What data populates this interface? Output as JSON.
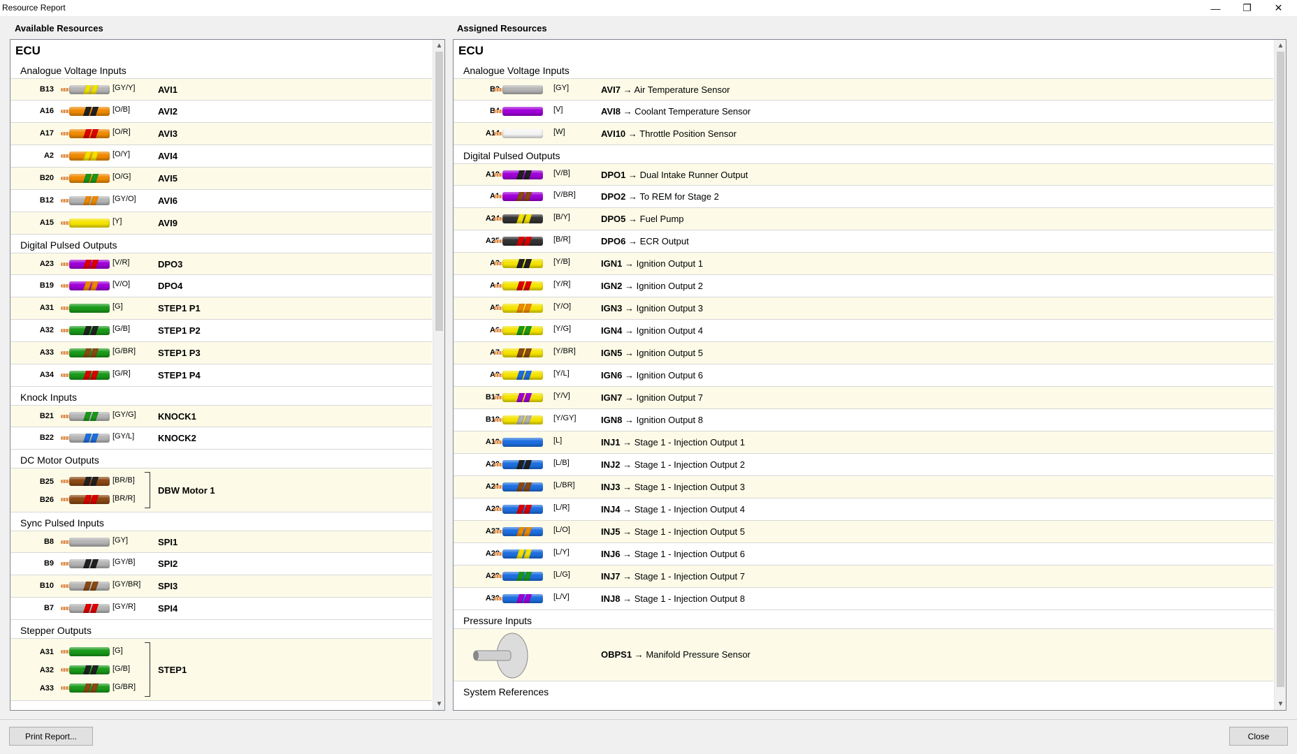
{
  "window": {
    "title": "Resource Report",
    "minimize": "—",
    "restore": "❐",
    "close": "✕"
  },
  "left": {
    "header": "Available Resources",
    "group": "ECU",
    "sections": [
      {
        "title": "Analogue Voltage Inputs",
        "rows": [
          {
            "pin": "B13",
            "code": "[GY/Y]",
            "name": "AVI1",
            "base": "#b5b5b5",
            "stripe": "#f5e400"
          },
          {
            "pin": "A16",
            "code": "[O/B]",
            "name": "AVI2",
            "base": "#f08a00",
            "stripe": "#222222"
          },
          {
            "pin": "A17",
            "code": "[O/R]",
            "name": "AVI3",
            "base": "#f08a00",
            "stripe": "#e00000"
          },
          {
            "pin": "A2",
            "code": "[O/Y]",
            "name": "AVI4",
            "base": "#f08a00",
            "stripe": "#f5e400"
          },
          {
            "pin": "B20",
            "code": "[O/G]",
            "name": "AVI5",
            "base": "#f08a00",
            "stripe": "#1a9a1a"
          },
          {
            "pin": "B12",
            "code": "[GY/O]",
            "name": "AVI6",
            "base": "#b5b5b5",
            "stripe": "#f08a00"
          },
          {
            "pin": "A15",
            "code": "[Y]",
            "name": "AVI9",
            "base": "#f5e400",
            "stripe": ""
          }
        ]
      },
      {
        "title": "Digital Pulsed Outputs",
        "rows": [
          {
            "pin": "A23",
            "code": "[V/R]",
            "name": "DPO3",
            "base": "#a000d8",
            "stripe": "#e00000"
          },
          {
            "pin": "B19",
            "code": "[V/O]",
            "name": "DPO4",
            "base": "#a000d8",
            "stripe": "#f08a00"
          },
          {
            "pin": "A31",
            "code": "[G]",
            "name": "STEP1 P1",
            "base": "#1a9a1a",
            "stripe": ""
          },
          {
            "pin": "A32",
            "code": "[G/B]",
            "name": "STEP1 P2",
            "base": "#1a9a1a",
            "stripe": "#222222"
          },
          {
            "pin": "A33",
            "code": "[G/BR]",
            "name": "STEP1 P3",
            "base": "#1a9a1a",
            "stripe": "#8b4a14"
          },
          {
            "pin": "A34",
            "code": "[G/R]",
            "name": "STEP1 P4",
            "base": "#1a9a1a",
            "stripe": "#e00000"
          }
        ]
      },
      {
        "title": "Knock Inputs",
        "rows": [
          {
            "pin": "B21",
            "code": "[GY/G]",
            "name": "KNOCK1",
            "base": "#b5b5b5",
            "stripe": "#1a9a1a"
          },
          {
            "pin": "B22",
            "code": "[GY/L]",
            "name": "KNOCK2",
            "base": "#b5b5b5",
            "stripe": "#1e6fe0"
          }
        ]
      },
      {
        "title": "DC Motor Outputs",
        "bracket": true,
        "name": "DBW Motor 1",
        "rows": [
          {
            "pin": "B25",
            "code": "[BR/B]",
            "base": "#8b4a14",
            "stripe": "#222222"
          },
          {
            "pin": "B26",
            "code": "[BR/R]",
            "base": "#8b4a14",
            "stripe": "#e00000"
          }
        ]
      },
      {
        "title": "Sync Pulsed Inputs",
        "rows": [
          {
            "pin": "B8",
            "code": "[GY]",
            "name": "SPI1",
            "base": "#b5b5b5",
            "stripe": ""
          },
          {
            "pin": "B9",
            "code": "[GY/B]",
            "name": "SPI2",
            "base": "#b5b5b5",
            "stripe": "#222222"
          },
          {
            "pin": "B10",
            "code": "[GY/BR]",
            "name": "SPI3",
            "base": "#b5b5b5",
            "stripe": "#8b4a14"
          },
          {
            "pin": "B7",
            "code": "[GY/R]",
            "name": "SPI4",
            "base": "#b5b5b5",
            "stripe": "#e00000"
          }
        ]
      },
      {
        "title": "Stepper Outputs",
        "bracket": true,
        "name": "STEP1",
        "rows": [
          {
            "pin": "A31",
            "code": "[G]",
            "base": "#1a9a1a",
            "stripe": ""
          },
          {
            "pin": "A32",
            "code": "[G/B]",
            "base": "#1a9a1a",
            "stripe": "#222222"
          },
          {
            "pin": "A33",
            "code": "[G/BR]",
            "base": "#1a9a1a",
            "stripe": "#8b4a14"
          }
        ]
      }
    ]
  },
  "right": {
    "header": "Assigned Resources",
    "group": "ECU",
    "sections": [
      {
        "title": "Analogue Voltage Inputs",
        "rows": [
          {
            "pin": "B3",
            "code": "[GY]",
            "name": "AVI7",
            "desc": "→ Air Temperature Sensor",
            "base": "#b5b5b5",
            "stripe": ""
          },
          {
            "pin": "B4",
            "code": "[V]",
            "name": "AVI8",
            "desc": "→ Coolant Temperature Sensor",
            "base": "#a000d8",
            "stripe": ""
          },
          {
            "pin": "A14",
            "code": "[W]",
            "name": "AVI10",
            "desc": "→ Throttle Position Sensor",
            "base": "#f4f4f4",
            "stripe": ""
          }
        ]
      },
      {
        "title": "Digital Pulsed Outputs",
        "rows": [
          {
            "pin": "A18",
            "code": "[V/B]",
            "name": "DPO1",
            "desc": "→ Dual Intake Runner Output",
            "base": "#a000d8",
            "stripe": "#222222"
          },
          {
            "pin": "A1",
            "code": "[V/BR]",
            "name": "DPO2",
            "desc": "→ To REM for Stage 2",
            "base": "#a000d8",
            "stripe": "#8b4a14"
          },
          {
            "pin": "A24",
            "code": "[B/Y]",
            "name": "DPO5",
            "desc": "→ Fuel Pump",
            "base": "#333333",
            "stripe": "#f5e400"
          },
          {
            "pin": "A25",
            "code": "[B/R]",
            "name": "DPO6",
            "desc": "→ ECR Output",
            "base": "#333333",
            "stripe": "#e00000"
          },
          {
            "pin": "A3",
            "code": "[Y/B]",
            "name": "IGN1",
            "desc": "→ Ignition Output 1",
            "base": "#f5e400",
            "stripe": "#222222"
          },
          {
            "pin": "A4",
            "code": "[Y/R]",
            "name": "IGN2",
            "desc": "→ Ignition Output 2",
            "base": "#f5e400",
            "stripe": "#e00000"
          },
          {
            "pin": "A5",
            "code": "[Y/O]",
            "name": "IGN3",
            "desc": "→ Ignition Output 3",
            "base": "#f5e400",
            "stripe": "#f08a00"
          },
          {
            "pin": "A6",
            "code": "[Y/G]",
            "name": "IGN4",
            "desc": "→ Ignition Output 4",
            "base": "#f5e400",
            "stripe": "#1a9a1a"
          },
          {
            "pin": "A7",
            "code": "[Y/BR]",
            "name": "IGN5",
            "desc": "→ Ignition Output 5",
            "base": "#f5e400",
            "stripe": "#8b4a14"
          },
          {
            "pin": "A8",
            "code": "[Y/L]",
            "name": "IGN6",
            "desc": "→ Ignition Output 6",
            "base": "#f5e400",
            "stripe": "#1e6fe0"
          },
          {
            "pin": "B17",
            "code": "[Y/V]",
            "name": "IGN7",
            "desc": "→ Ignition Output 7",
            "base": "#f5e400",
            "stripe": "#a000d8"
          },
          {
            "pin": "B18",
            "code": "[Y/GY]",
            "name": "IGN8",
            "desc": "→ Ignition Output 8",
            "base": "#f5e400",
            "stripe": "#b5b5b5"
          },
          {
            "pin": "A19",
            "code": "[L]",
            "name": "INJ1",
            "desc": "→ Stage 1 - Injection Output 1",
            "base": "#1e6fe0",
            "stripe": ""
          },
          {
            "pin": "A20",
            "code": "[L/B]",
            "name": "INJ2",
            "desc": "→ Stage 1 - Injection Output 2",
            "base": "#1e6fe0",
            "stripe": "#222222"
          },
          {
            "pin": "A21",
            "code": "[L/BR]",
            "name": "INJ3",
            "desc": "→ Stage 1 - Injection Output 3",
            "base": "#1e6fe0",
            "stripe": "#8b4a14"
          },
          {
            "pin": "A22",
            "code": "[L/R]",
            "name": "INJ4",
            "desc": "→ Stage 1 - Injection Output 4",
            "base": "#1e6fe0",
            "stripe": "#e00000"
          },
          {
            "pin": "A27",
            "code": "[L/O]",
            "name": "INJ5",
            "desc": "→ Stage 1 - Injection Output 5",
            "base": "#1e6fe0",
            "stripe": "#f08a00"
          },
          {
            "pin": "A28",
            "code": "[L/Y]",
            "name": "INJ6",
            "desc": "→ Stage 1 - Injection Output 6",
            "base": "#1e6fe0",
            "stripe": "#f5e400"
          },
          {
            "pin": "A29",
            "code": "[L/G]",
            "name": "INJ7",
            "desc": "→ Stage 1 - Injection Output 7",
            "base": "#1e6fe0",
            "stripe": "#1a9a1a"
          },
          {
            "pin": "A30",
            "code": "[L/V]",
            "name": "INJ8",
            "desc": "→ Stage 1 - Injection Output 8",
            "base": "#1e6fe0",
            "stripe": "#a000d8"
          }
        ]
      },
      {
        "title": "Pressure Inputs",
        "pressure": true,
        "name": "OBPS1",
        "desc": "→ Manifold Pressure Sensor"
      },
      {
        "title": "System References"
      }
    ]
  },
  "footer": {
    "print": "Print Report...",
    "close": "Close"
  }
}
